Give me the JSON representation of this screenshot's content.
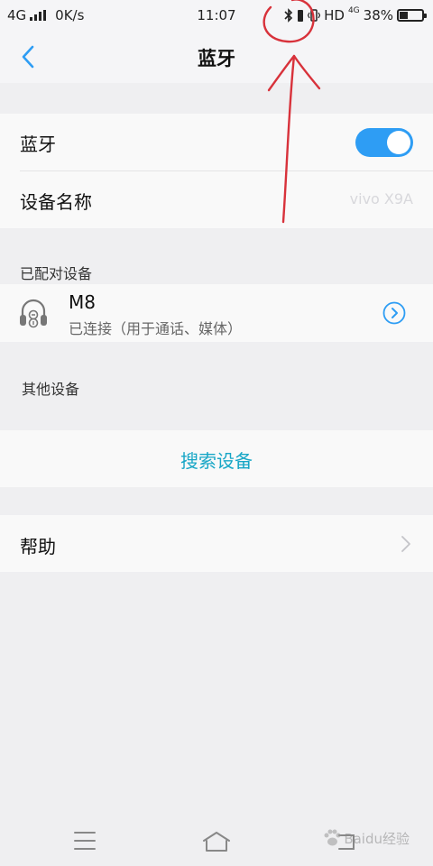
{
  "status_bar": {
    "network": "4G",
    "speed": "0K/s",
    "time": "11:07",
    "hd": "HD",
    "network_right": "4G",
    "battery_percent": "38%",
    "battery_level": 0.38
  },
  "header": {
    "title": "蓝牙",
    "back_icon": "chevron-left-icon"
  },
  "bluetooth": {
    "label": "蓝牙",
    "enabled": true,
    "toggle_color": "#2e9df4"
  },
  "device_name": {
    "label": "设备名称",
    "value": "vivo X9A"
  },
  "paired": {
    "section_title": "已配对设备",
    "devices": [
      {
        "name": "M8",
        "status": "已连接（用于通话、媒体）",
        "icon": "headset-icon"
      }
    ]
  },
  "other_devices": {
    "section_title": "其他设备"
  },
  "search": {
    "label": "搜索设备",
    "color": "#17a6c6"
  },
  "help": {
    "label": "帮助"
  },
  "watermark": {
    "text": "Baidu经验"
  },
  "colors": {
    "accent": "#2e9df4",
    "link": "#17a6c6",
    "annotation": "#d8323b"
  }
}
